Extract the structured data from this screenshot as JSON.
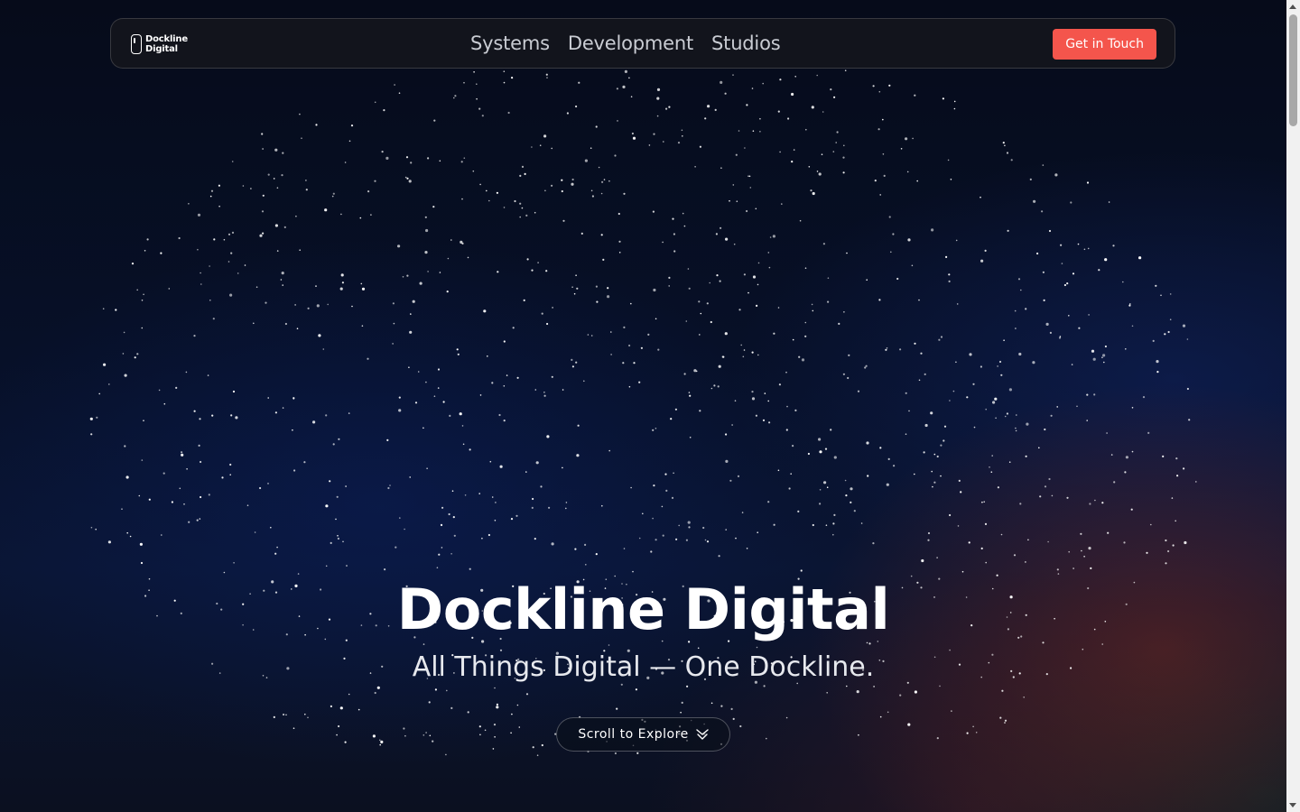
{
  "brand": {
    "logo_line1": "Dockline",
    "logo_line2": "Digital",
    "logo_icon": "bracket-logo-icon"
  },
  "nav": {
    "links": [
      {
        "label": "Systems"
      },
      {
        "label": "Development"
      },
      {
        "label": "Studios"
      }
    ],
    "cta_label": "Get in Touch"
  },
  "hero": {
    "title": "Dockline Digital",
    "subtitle": "All Things Digital — One Dockline.",
    "scroll_label": "Scroll to Explore",
    "scroll_icon": "chevron-down-icon"
  },
  "colors": {
    "accent": "#f4554c",
    "background": "#050a18",
    "text": "#ffffff"
  }
}
